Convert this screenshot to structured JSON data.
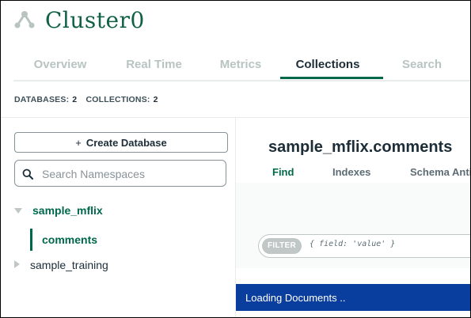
{
  "cluster": {
    "name": "Cluster0",
    "icon": "cluster-icon"
  },
  "tabs": [
    {
      "label": "Overview",
      "active": false
    },
    {
      "label": "Real Time",
      "active": false
    },
    {
      "label": "Metrics",
      "active": false
    },
    {
      "label": "Collections",
      "active": true
    },
    {
      "label": "Search",
      "active": false
    }
  ],
  "stats": {
    "databases_label": "DATABASES:",
    "databases_count": "2",
    "collections_label": "COLLECTIONS:",
    "collections_count": "2"
  },
  "sidebar": {
    "create_db_label": "Create Database",
    "create_db_icon": "plus-icon",
    "search_placeholder": "Search Namespaces",
    "search_icon": "search-icon",
    "databases": [
      {
        "name": "sample_mflix",
        "expanded": true,
        "collections": [
          {
            "name": "comments",
            "active": true
          }
        ]
      },
      {
        "name": "sample_training",
        "expanded": false,
        "collections": []
      }
    ]
  },
  "main": {
    "namespace": "sample_mflix.comments",
    "subtabs": [
      {
        "label": "Find",
        "active": true
      },
      {
        "label": "Indexes",
        "active": false
      },
      {
        "label": "Schema Anti-Patterns",
        "active": false
      }
    ],
    "filter": {
      "badge": "FILTER",
      "placeholder": "{ field: 'value' }"
    },
    "loading_text": "Loading Documents .."
  },
  "colors": {
    "brand_green": "#00684a",
    "title_green": "#116149",
    "loading_blue": "#0a3e9e"
  }
}
